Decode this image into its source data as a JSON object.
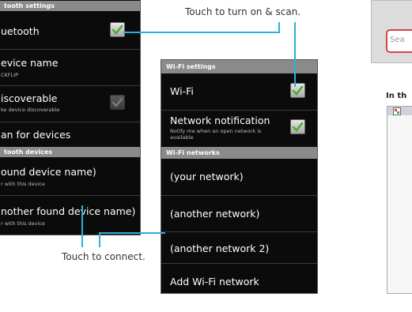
{
  "bluetooth_settings": {
    "header": "tooth settings",
    "rows": [
      {
        "title": "uetooth"
      },
      {
        "title": "evice name",
        "subtitle": "CKFLIP"
      },
      {
        "title": "iscoverable",
        "subtitle": "ke device discoverable"
      },
      {
        "title": "an for devices"
      }
    ],
    "devices_header": "tooth devices",
    "devices": [
      {
        "title": "ound device name)",
        "subtitle": "r with this device"
      },
      {
        "title": "nother found device name)",
        "subtitle": "r with this device"
      }
    ]
  },
  "wifi_settings": {
    "header": "Wi-Fi settings",
    "wifi_label": "Wi-Fi",
    "notification_label": "Network notification",
    "notification_sub": "Notify me when an open network is available",
    "networks_header": "Wi-Fi networks",
    "networks": [
      "(your network)",
      "(another network)",
      "(another network 2)"
    ],
    "add_network": "Add Wi-Fi network"
  },
  "callouts": {
    "turn_on": "Touch to turn on & scan.",
    "connect": "Touch to connect."
  },
  "right_fragment": {
    "search_placeholder": "Sea",
    "heading": "In th"
  },
  "colors": {
    "accent": "#2bb1d6",
    "check_green": "#4caf2a"
  }
}
